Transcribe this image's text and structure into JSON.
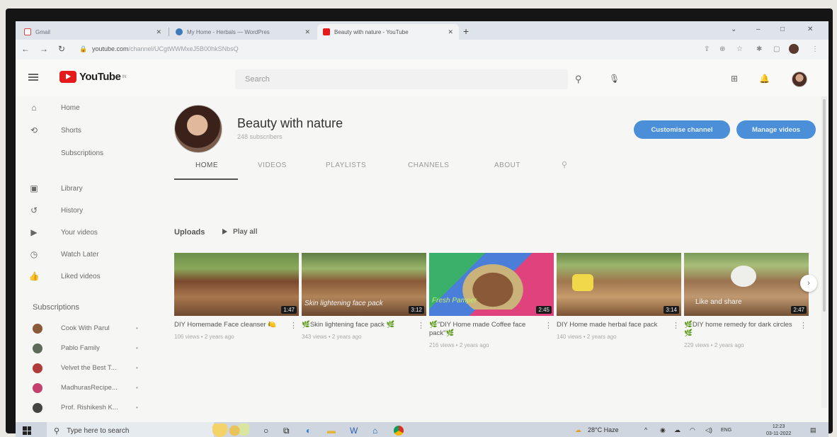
{
  "browser": {
    "tabs": [
      {
        "label": "Gmail",
        "icon": "gmail-icon"
      },
      {
        "label": "My Home - Herbals — WordPres",
        "icon": "wordpress-icon"
      },
      {
        "label": "Beauty with nature - YouTube",
        "icon": "youtube-icon"
      }
    ],
    "url_domain": "youtube.com",
    "url_path": "/channel/UCgtWWMxeJ5B00hkSNbsQ",
    "window_controls": {
      "minimize": "–",
      "maximize": "□",
      "close": "✕",
      "tabmenu": "⌄"
    }
  },
  "youtube": {
    "logo_text": "YouTube",
    "logo_region": "IN",
    "search_placeholder": "Search"
  },
  "sidebar": {
    "primary": [
      {
        "label": "Home",
        "icon": "home-icon",
        "glyph": "⌂"
      },
      {
        "label": "Shorts",
        "icon": "shorts-icon",
        "glyph": "⟲"
      },
      {
        "label": "Subscriptions",
        "icon": "subscriptions-icon",
        "glyph": ""
      }
    ],
    "secondary": [
      {
        "label": "Library",
        "icon": "library-icon",
        "glyph": "▣"
      },
      {
        "label": "History",
        "icon": "history-icon",
        "glyph": "↺"
      },
      {
        "label": "Your videos",
        "icon": "your-videos-icon",
        "glyph": "▶"
      },
      {
        "label": "Watch Later",
        "icon": "watch-later-icon",
        "glyph": "◷"
      },
      {
        "label": "Liked videos",
        "icon": "like-icon",
        "glyph": "👍"
      }
    ],
    "subscriptions_heading": "Subscriptions",
    "subscriptions": [
      {
        "label": "Cook With Parul",
        "color": "#8a5a3b"
      },
      {
        "label": "Pablo Family",
        "color": "#5f6a5a"
      },
      {
        "label": "Velvet the Best T...",
        "color": "#b03a3a"
      },
      {
        "label": "MadhurasRecipe...",
        "color": "#c4406e"
      },
      {
        "label": "Prof. Rishikesh K...",
        "color": "#444444"
      }
    ]
  },
  "channel": {
    "name": "Beauty with nature",
    "subscribers": "248 subscribers",
    "customise_button": "Customise channel",
    "manage_button": "Manage videos",
    "tabs": [
      "HOME",
      "VIDEOS",
      "PLAYLISTS",
      "CHANNELS",
      "ABOUT"
    ],
    "active_tab": "HOME"
  },
  "uploads": {
    "heading": "Uploads",
    "play_all": "Play all",
    "videos": [
      {
        "title": "DIY Homemade Face cleanser 🍋",
        "meta": "106 views • 2 years ago",
        "duration": "1:47",
        "overlay": ""
      },
      {
        "title": "🌿Skin lightening face pack 🌿",
        "meta": "343 views • 2 years ago",
        "duration": "3:12",
        "overlay": "Skin lightening face pack"
      },
      {
        "title": "🌿\"DIY Home made Coffee face pack\"🌿",
        "meta": "216 views • 2 years ago",
        "duration": "2:45",
        "overlay": "Fresh Pamper"
      },
      {
        "title": "DIY Home made herbal face pack",
        "meta": "140 views • 2 years ago",
        "duration": "3:14",
        "overlay": ""
      },
      {
        "title": "🌿DIY home remedy for dark circles 🌿",
        "meta": "229 views • 2 years ago",
        "duration": "2:47",
        "overlay": "Like and share"
      }
    ]
  },
  "taskbar": {
    "search_placeholder": "Type here to search",
    "weather": "28°C Haze",
    "language": "ENG",
    "time": "12:23",
    "date": "03-11-2022"
  }
}
